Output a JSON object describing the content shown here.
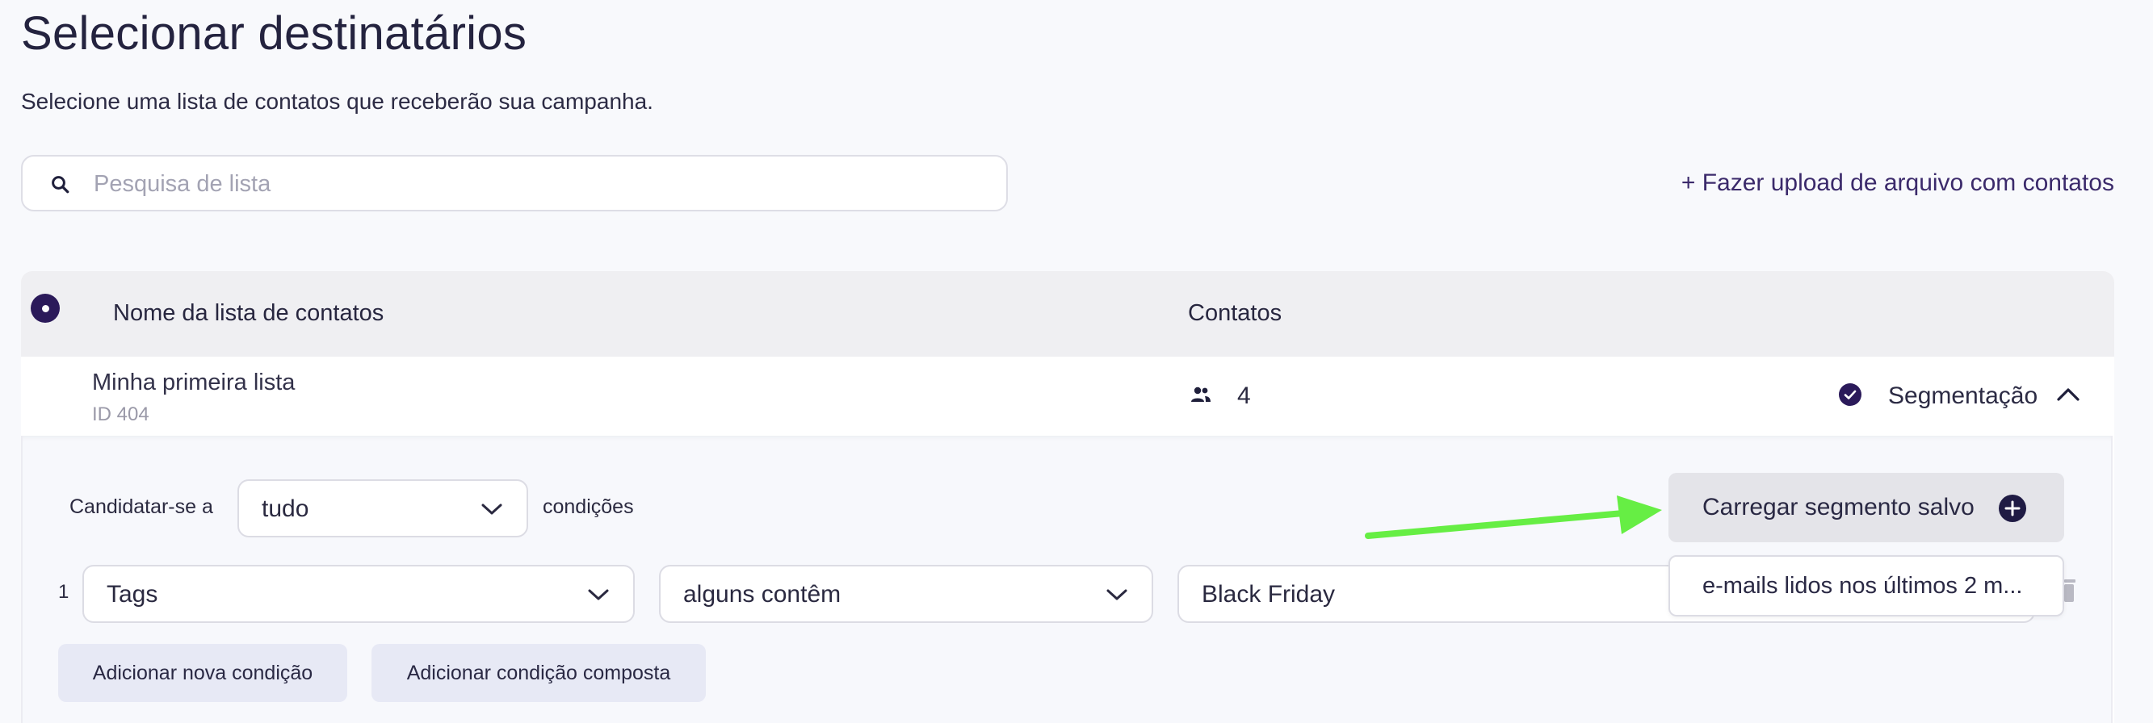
{
  "page": {
    "title": "Selecionar destinatários",
    "subtitle": "Selecione uma lista de contatos que receberão sua campanha."
  },
  "search": {
    "placeholder": "Pesquisa de lista",
    "value": ""
  },
  "upload_link": "+ Fazer upload de arquivo com contatos",
  "table": {
    "headers": {
      "name": "Nome da lista de contatos",
      "contacts": "Contatos"
    },
    "rows": [
      {
        "name": "Minha primeira lista",
        "id_text": "ID 404",
        "contacts": "4",
        "segmentation_label": "Segmentação",
        "selected": true
      }
    ]
  },
  "segment": {
    "apply_prefix": "Candidatar-se a",
    "match_select": "tudo",
    "apply_suffix": "condições",
    "load_saved_label": "Carregar segmento salvo",
    "saved_options": [
      "e-mails lidos nos últimos 2 m..."
    ],
    "conditions": [
      {
        "index": "1",
        "field": "Tags",
        "operator": "alguns contêm",
        "value": "Black Friday"
      }
    ],
    "add_condition_label": "Adicionar nova condição",
    "add_compound_label": "Adicionar condição composta"
  },
  "colors": {
    "accent": "#2b1a5a",
    "annotation_arrow": "#66ee44",
    "header_bg": "#efeff2",
    "button_light": "#e7e9f5"
  },
  "icons": [
    "search-icon",
    "people-icon",
    "check-circle-icon",
    "chevron-up-icon",
    "chevron-down-icon",
    "plus-circle-icon",
    "trash-icon"
  ]
}
